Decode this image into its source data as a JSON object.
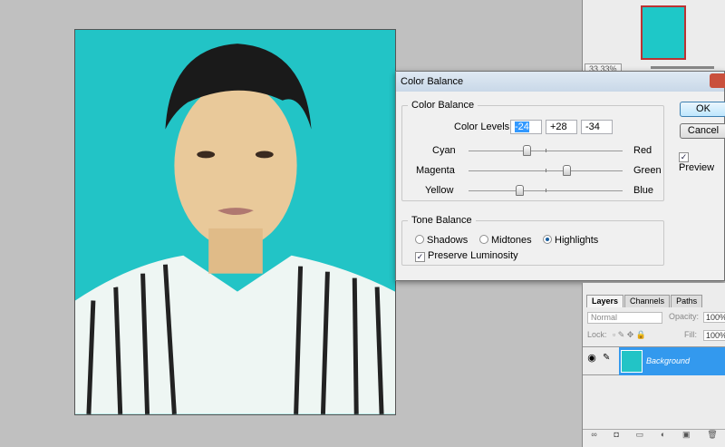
{
  "navigator": {
    "zoom": "33.33%"
  },
  "dialog": {
    "title": "Color Balance",
    "group_color": "Color Balance",
    "color_levels_label": "Color Levels:",
    "levels": [
      "-24",
      "+28",
      "-34"
    ],
    "sliders": [
      {
        "left": "Cyan",
        "right": "Red",
        "value": -24
      },
      {
        "left": "Magenta",
        "right": "Green",
        "value": 28
      },
      {
        "left": "Yellow",
        "right": "Blue",
        "value": -34
      }
    ],
    "group_tone": "Tone Balance",
    "tones": [
      "Shadows",
      "Midtones",
      "Highlights"
    ],
    "selected_tone": "Highlights",
    "preserve_luminosity": "Preserve Luminosity",
    "ok": "OK",
    "cancel": "Cancel",
    "preview": "Preview"
  },
  "layers": {
    "tabs": [
      "Layers",
      "Channels",
      "Paths"
    ],
    "blend_mode": "Normal",
    "opacity_label": "Opacity:",
    "opacity": "100%",
    "lock_label": "Lock:",
    "fill_label": "Fill:",
    "fill": "100%",
    "layer_name": "Background"
  }
}
